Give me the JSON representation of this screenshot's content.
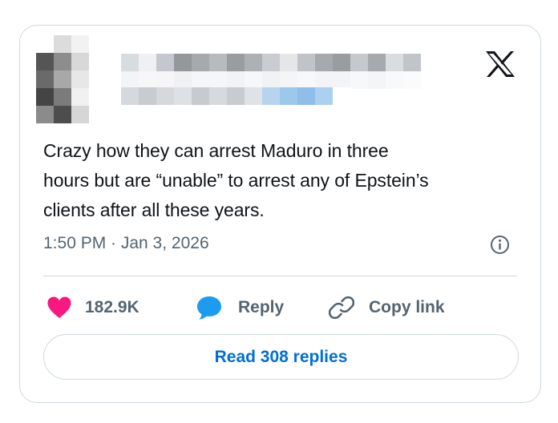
{
  "author": {
    "avatar_pixels": [
      [
        "#ffffff",
        "#dcdcdc",
        "#f2f2f2",
        "#ffffff",
        "#ffffff"
      ],
      [
        "#555555",
        "#8d8d8d",
        "#d8d8d8",
        "#ffffff",
        "#ffffff"
      ],
      [
        "#6a6a6a",
        "#a8a8a8",
        "#e7e7e7",
        "#ffffff",
        "#ffffff"
      ],
      [
        "#444444",
        "#7b7b7b",
        "#f1f1f1",
        "#ffffff",
        "#ffffff"
      ],
      [
        "#8b8b8b",
        "#4d4d4d",
        "#d6d6d6",
        "#ffffff",
        "#ffffff"
      ]
    ],
    "name_pixels": [
      [
        "#d7dce1",
        "#eef0f3",
        "#c4c8ce",
        "#959899",
        "#a7aaad",
        "#b7bbbe",
        "#9a9d9f",
        "#adb1b5",
        "#c9ccd0",
        "#e4e6e8",
        "#c0c4c9",
        "#a6aaae",
        "#9a9d9f",
        "#c5c9cd",
        "#a6a9ad",
        "#dadddf",
        "#c1c5c9",
        "#ffffff"
      ],
      [
        "#f2f4f6",
        "#f7f7f8",
        "#f6f6f7",
        "#f0f1f2",
        "#f5f6f7",
        "#f5f6f7",
        "#f2f3f4",
        "#f6f7f8",
        "#f1f2f3",
        "#f4f5f6",
        "#f7f8f9",
        "#f3f4f5",
        "#f3f4f5",
        "#f7f8f9",
        "#f4f5f6",
        "#f8f9fa",
        "#fbfbfc",
        "#ffffff"
      ]
    ],
    "handle_pixels": [
      [
        "#d5d9de",
        "#c7ccd1",
        "#d5d9dd",
        "#dde1e5",
        "#c6cbd0",
        "#d6dadf",
        "#c7ccd1",
        "#dfe3e7",
        "#b7d4ee",
        "#9cc8ec",
        "#8fbfe8",
        "#acd0ef",
        "#ffffff"
      ]
    ]
  },
  "tweet": {
    "lines": [
      "Crazy how they can arrest Maduro in three",
      "hours but are “unable” to arrest any of Epstein’s",
      "clients after all these years."
    ],
    "timestamp": "1:50 PM · Jan 3, 2026"
  },
  "actions": {
    "like_count": "182.9K",
    "reply_label": "Reply",
    "copy_label": "Copy link"
  },
  "read_replies_label": "Read 308 replies",
  "icons": {
    "logo": "x-logo-icon",
    "info": "info-icon",
    "like": "heart-icon",
    "reply": "speech-bubble-icon",
    "copy": "link-icon"
  },
  "colors": {
    "heart": "#f91880",
    "reply": "#1d9bf0",
    "link": "#006fd6",
    "text": "#0f1419",
    "muted": "#536471",
    "border": "#cfd9de"
  }
}
